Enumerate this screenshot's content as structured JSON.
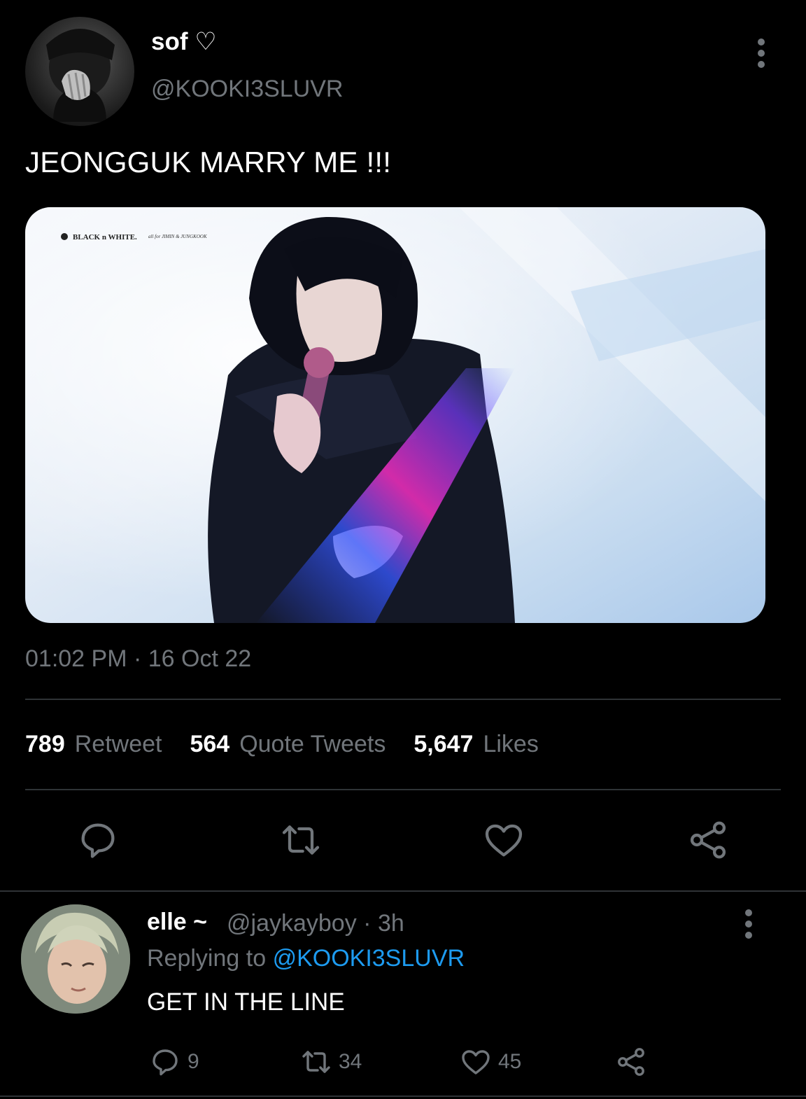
{
  "tweet": {
    "author": {
      "display_name": "sof ♡",
      "handle": "@KOOKI3SLUVR",
      "avatar": "user-avatar"
    },
    "text": "JEONGGUK MARRY ME !!!",
    "media": {
      "watermark_left": "BLACK n WHITE.",
      "watermark_right": "all for JIMIN & JUNGKOOK"
    },
    "time": "01:02 PM",
    "date": "16 Oct 22",
    "stats": {
      "retweets_count": "789",
      "retweets_label": "Retweet",
      "quotes_count": "564",
      "quotes_label": "Quote Tweets",
      "likes_count": "5,647",
      "likes_label": "Likes"
    },
    "actions": [
      "reply-icon",
      "retweet-icon",
      "like-icon",
      "share-icon"
    ]
  },
  "reply": {
    "display_name": "elle ~",
    "handle": "@jaykayboy",
    "age": "3h",
    "replying_prefix": "Replying to",
    "replying_to": "@KOOKI3SLUVR",
    "text": "GET IN THE LINE",
    "counts": {
      "replies": "9",
      "retweets": "34",
      "likes": "45"
    }
  },
  "colors": {
    "background": "#000000",
    "text_primary": "#ffffff",
    "text_secondary": "#71767b",
    "divider": "#2f3336",
    "accent": "#1d9bf0"
  }
}
